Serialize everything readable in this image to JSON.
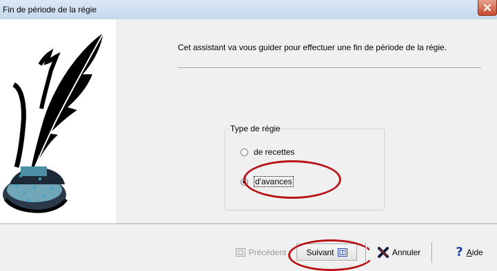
{
  "window": {
    "title": "Fin de période de la régie"
  },
  "wizard": {
    "intro_text": "Cet assistant va vous guider pour effectuer une fin de période de la régie.",
    "group_title": "Type de régie",
    "options": [
      {
        "label": "de recettes",
        "selected": false
      },
      {
        "label": "d'avances",
        "selected": true
      }
    ]
  },
  "buttons": {
    "previous": "Précédent",
    "next": "Suivant",
    "cancel": "Annuler",
    "help_prefix": "A",
    "help_rest": "ide"
  },
  "icons": {
    "close": "close-icon",
    "quill": "quill-ink-icon",
    "previous": "previous-icon",
    "next": "next-icon",
    "cancel": "cancel-x-icon",
    "help": "help-question-icon"
  },
  "colors": {
    "annotation": "#b81418",
    "help_icon": "#1e3fa8",
    "cancel_icon": "#0b1a3a"
  }
}
